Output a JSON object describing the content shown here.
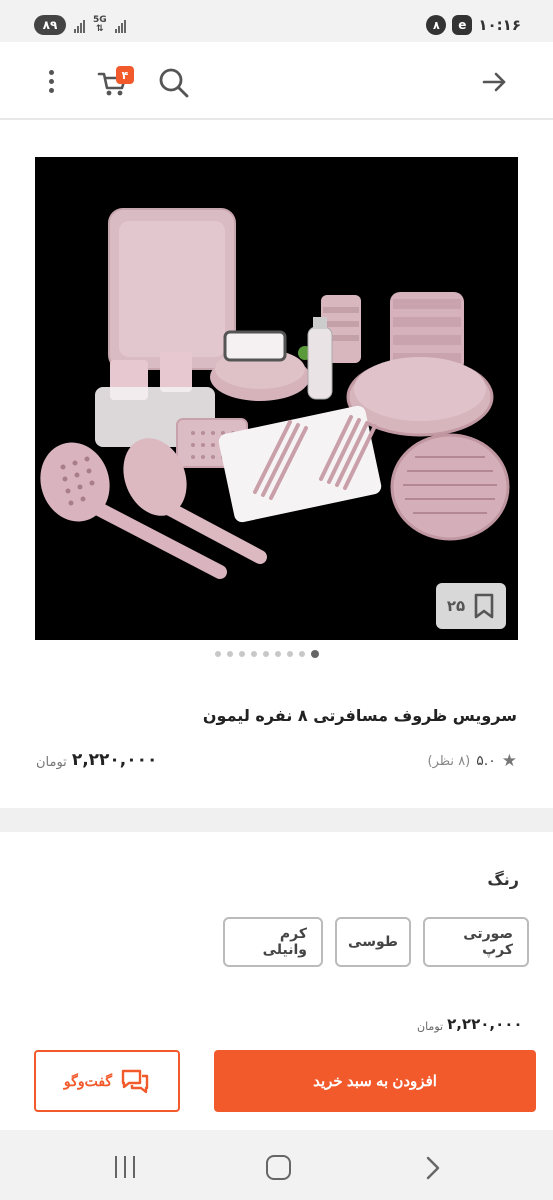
{
  "status_bar": {
    "battery": "۸۹",
    "network": "5G",
    "time": "۱۰:۱۶",
    "notification_count": "۸"
  },
  "header": {
    "cart_count": "۴",
    "icons": [
      "menu-icon",
      "cart-icon",
      "search-icon",
      "back-arrow-icon"
    ]
  },
  "gallery": {
    "save_count": "۲۵",
    "dots_total": 9,
    "active_dot": 9
  },
  "product": {
    "title": "سرویس ظروف مسافرتی ۸ نفره لیمون",
    "rating": "۵.۰",
    "rating_count": "(۸ نظر)",
    "price": "۲,۲۲۰,۰۰۰",
    "price_unit": "تومان"
  },
  "color_section": {
    "label": "رنگ",
    "options": [
      "صورتی کرپ",
      "طوسی",
      "کرم وانیلی"
    ]
  },
  "footer": {
    "price": "۲,۲۲۰,۰۰۰",
    "price_unit": "تومان",
    "add_to_cart": "افزودن به سبد خرید",
    "chat": "گفت‌وگو"
  },
  "colors": {
    "accent": "#f25a2c",
    "product_pink": "#d8b8bf",
    "background_gray": "#f0f0f0"
  }
}
